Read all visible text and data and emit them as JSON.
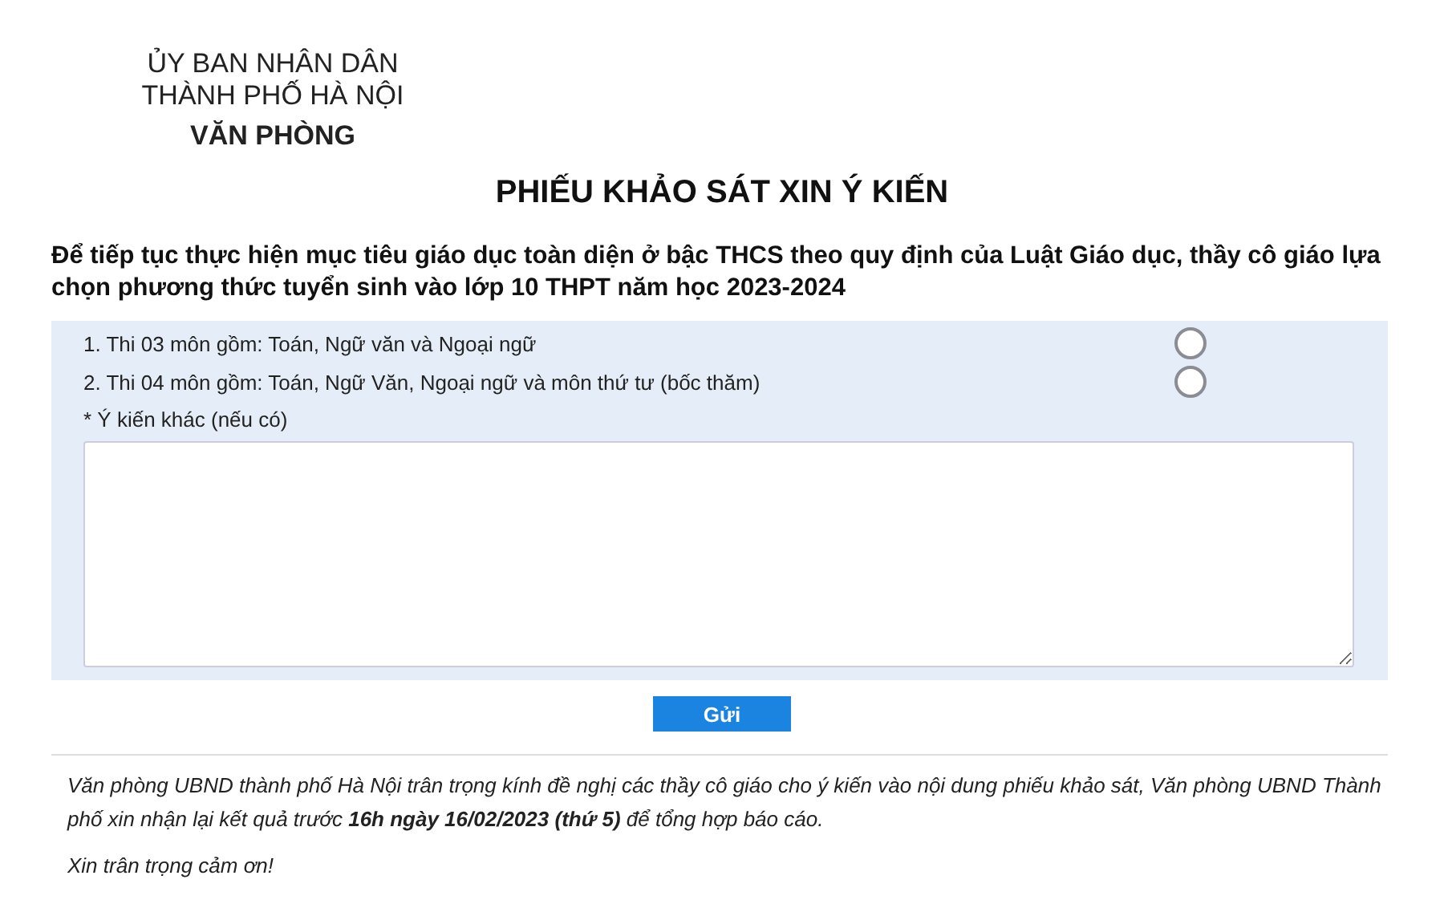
{
  "header": {
    "organization": "ỦY BAN NHÂN DÂN",
    "city": "THÀNH PHỐ HÀ NỘI",
    "office": "VĂN PHÒNG"
  },
  "title": "PHIẾU KHẢO SÁT XIN Ý KIẾN",
  "question": "Để tiếp tục thực hiện mục tiêu giáo dục toàn diện ở bậc THCS theo quy định của Luật Giáo dục, thầy cô giáo lựa chọn phương thức tuyển sinh vào lớp 10 THPT năm học 2023-2024",
  "options": [
    {
      "label": "1. Thi 03 môn gồm: Toán, Ngữ văn và Ngoại ngữ",
      "selected": false
    },
    {
      "label": "2. Thi 04 môn gồm: Toán, Ngữ Văn, Ngoại ngữ và môn thứ tư (bốc thăm)",
      "selected": false
    }
  ],
  "comment": {
    "label": "* Ý kiến khác (nếu có)"
  },
  "submit_button": "Gửi",
  "notes": [
    "Văn phòng UBND thành phố Hà Nội trân trọng kính đề nghị các thầy cô giáo cho ý kiến vào nội dung phiếu khảo sát, Văn phòng UBND Thành phố xin nhận lại kết quả trước **16h ngày 16/02/2023 (thứ 5)** để tổng hợp báo cáo.",
    "Xin trân trọng cảm ơn!"
  ]
}
